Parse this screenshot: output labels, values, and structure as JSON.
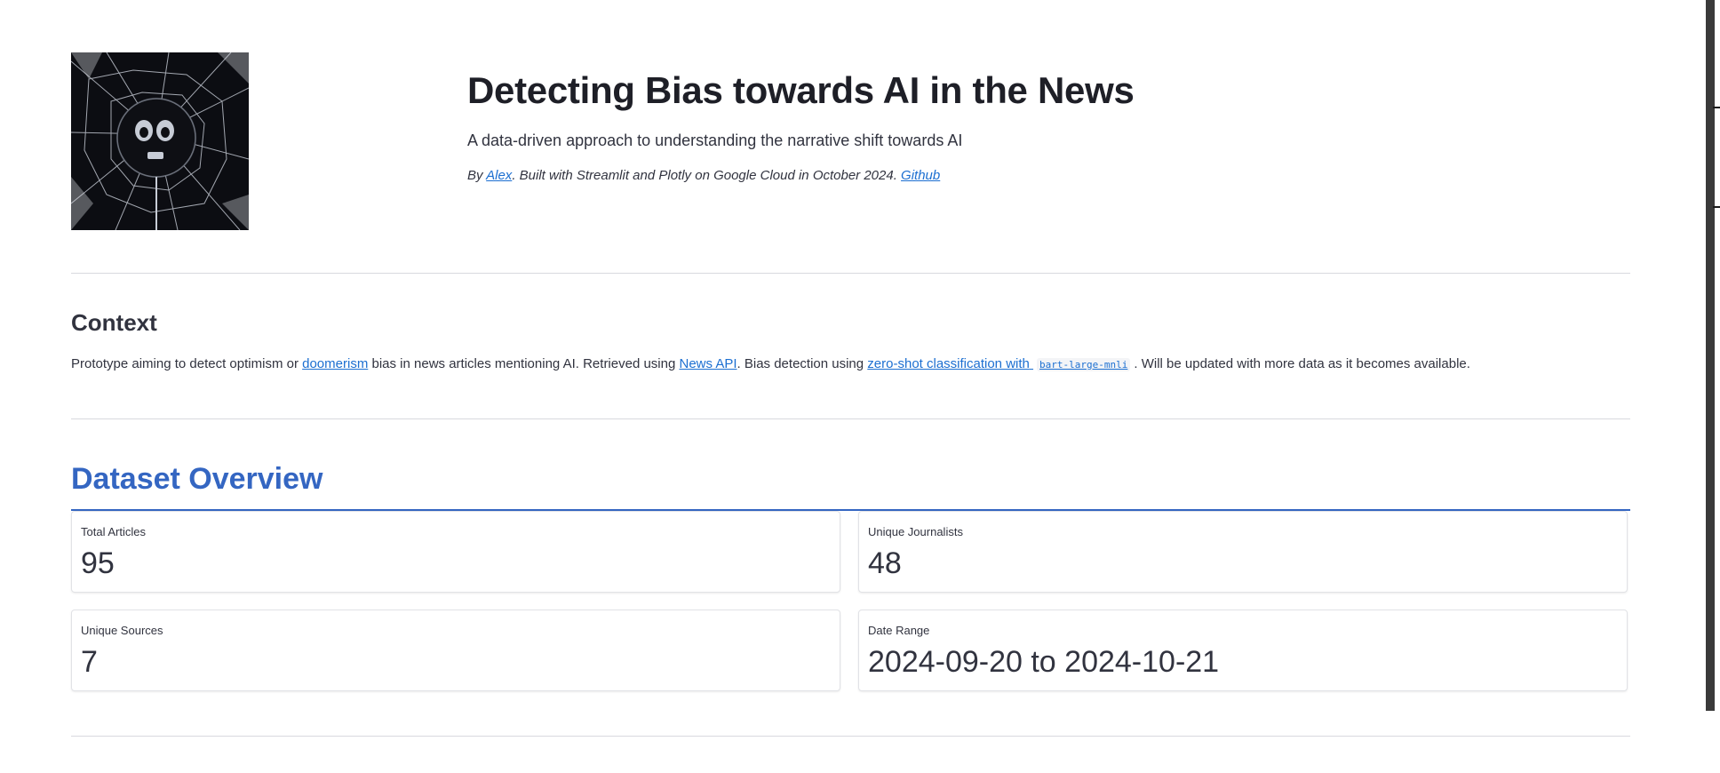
{
  "header": {
    "logo_icon": "shattered-glass-skull-icon",
    "title": "Detecting Bias towards AI in the News",
    "subtitle": "A data-driven approach to understanding the narrative shift towards AI",
    "byline": {
      "prefix": "By ",
      "author_link": "Alex",
      "middle": ". Built with Streamlit and Plotly on Google Cloud in October 2024. ",
      "github_link": "Github"
    }
  },
  "context": {
    "title": "Context",
    "text_1": "Prototype aiming to detect optimism or ",
    "link_doomerism": "doomerism",
    "text_2": " bias in news articles mentioning AI. Retrieved using ",
    "link_newsapi": "News API",
    "text_3": ". Bias detection using ",
    "link_zeroshot": "zero-shot classification with",
    "code_model": "bart-large-mnli",
    "text_4": ". Will be updated with more data as it becomes available."
  },
  "overview": {
    "title": "Dataset Overview",
    "metrics": [
      {
        "label": "Total Articles",
        "value": "95"
      },
      {
        "label": "Unique Journalists",
        "value": "48"
      },
      {
        "label": "Unique Sources",
        "value": "7"
      },
      {
        "label": "Date Range",
        "value": "2024-09-20 to 2024-10-21"
      }
    ]
  },
  "colors": {
    "accent": "#3466c2",
    "link": "#1c6fd1",
    "text": "#31333f"
  }
}
